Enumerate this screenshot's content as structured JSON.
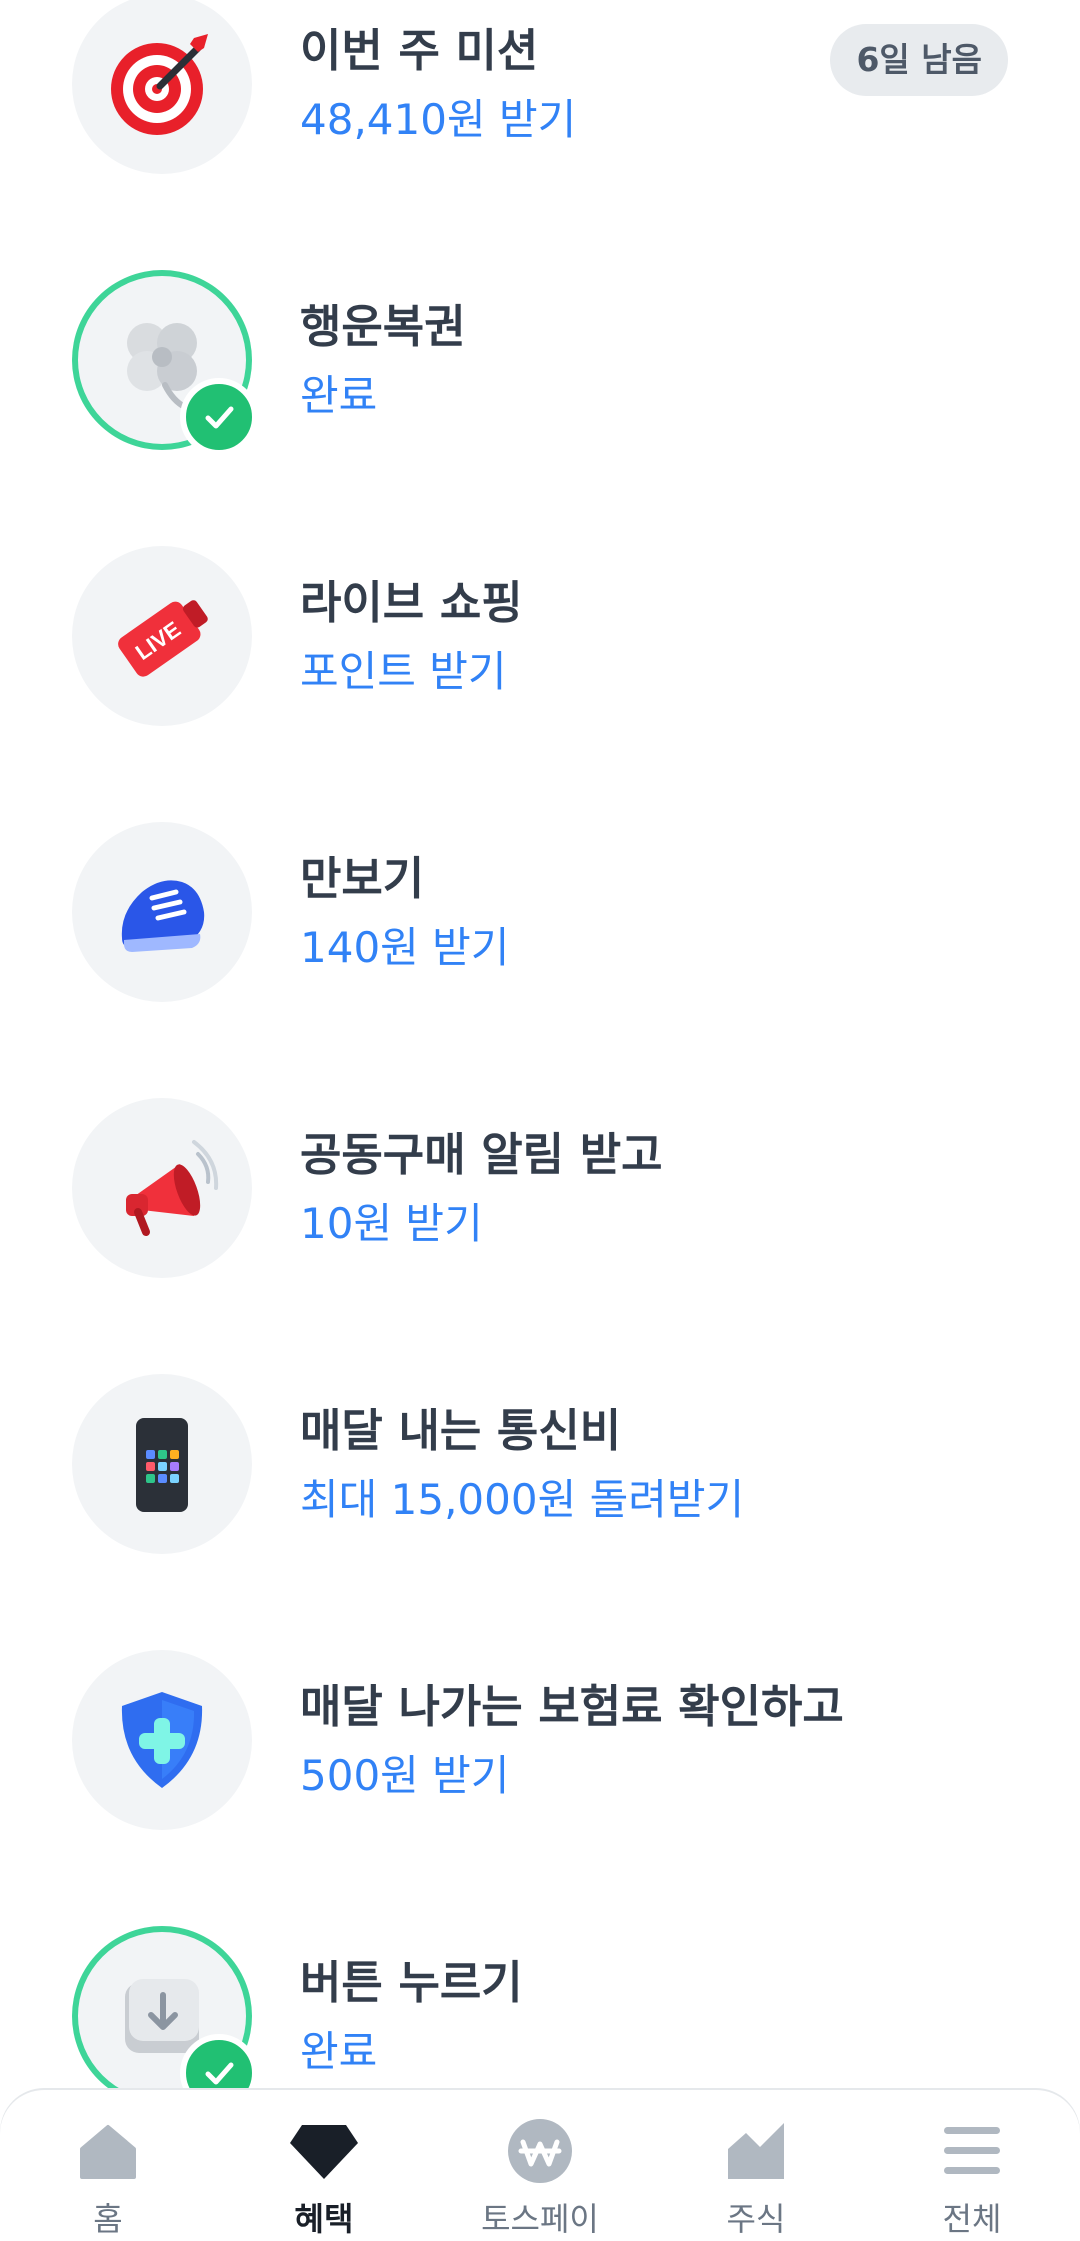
{
  "items": [
    {
      "title": "이번 주 미션",
      "sub": "48,410원 받기",
      "badge": "6일 남음",
      "icon": "target-dart-icon",
      "done": false
    },
    {
      "title": "행운복권",
      "sub": "완료",
      "icon": "clover-icon",
      "done": true
    },
    {
      "title": "라이브 쇼핑",
      "sub": "포인트 받기",
      "icon": "live-tag-icon",
      "done": false
    },
    {
      "title": "만보기",
      "sub": "140원 받기",
      "icon": "sneaker-icon",
      "done": false
    },
    {
      "title": "공동구매 알림 받고",
      "sub": "10원 받기",
      "icon": "megaphone-icon",
      "done": false
    },
    {
      "title": "매달 내는 통신비",
      "sub": "최대 15,000원 돌려받기",
      "icon": "phone-icon",
      "done": false
    },
    {
      "title": "매달 나가는 보험료 확인하고",
      "sub": "500원 받기",
      "icon": "shield-plus-icon",
      "done": false
    },
    {
      "title": "버튼 누르기",
      "sub": "완료",
      "icon": "key-button-icon",
      "done": true
    }
  ],
  "tabbar": {
    "tabs": [
      {
        "label": "홈",
        "icon": "home-icon"
      },
      {
        "label": "혜택",
        "icon": "diamond-icon",
        "active": true
      },
      {
        "label": "토스페이",
        "icon": "won-coin-icon"
      },
      {
        "label": "주식",
        "icon": "chart-icon"
      },
      {
        "label": "전체",
        "icon": "menu-icon"
      }
    ]
  },
  "colors": {
    "accent": "#3182f6",
    "done_ring": "#3ed598",
    "check_bg": "#21c073",
    "title": "#333d4b"
  }
}
